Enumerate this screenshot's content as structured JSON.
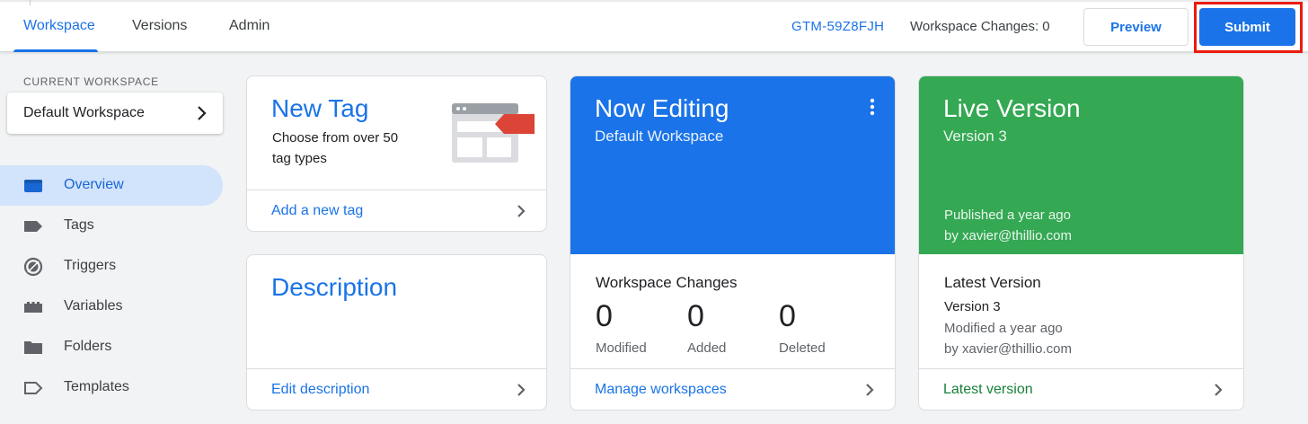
{
  "topbar": {
    "tabs": [
      {
        "label": "Workspace",
        "active": true
      },
      {
        "label": "Versions",
        "active": false
      },
      {
        "label": "Admin",
        "active": false
      }
    ],
    "container_id": "GTM-59Z8FJH",
    "workspace_changes": "Workspace Changes: 0",
    "preview_label": "Preview",
    "submit_label": "Submit",
    "highlight_color": "#ea1c0e"
  },
  "sidebar": {
    "current_workspace_label": "CURRENT WORKSPACE",
    "workspace_name": "Default Workspace",
    "items": [
      {
        "label": "Overview",
        "icon": "overview-icon",
        "active": true
      },
      {
        "label": "Tags",
        "icon": "tag-icon",
        "active": false
      },
      {
        "label": "Triggers",
        "icon": "trigger-icon",
        "active": false
      },
      {
        "label": "Variables",
        "icon": "variables-icon",
        "active": false
      },
      {
        "label": "Folders",
        "icon": "folder-icon",
        "active": false
      },
      {
        "label": "Templates",
        "icon": "template-icon",
        "active": false
      }
    ]
  },
  "new_tag_card": {
    "title": "New Tag",
    "subtitle_line1": "Choose from over 50",
    "subtitle_line2": "tag types",
    "link": "Add a new tag"
  },
  "description_card": {
    "title": "Description",
    "link": "Edit description"
  },
  "now_editing_card": {
    "title": "Now Editing",
    "subtitle": "Default Workspace",
    "color": "#1a73e8",
    "section_title": "Workspace Changes",
    "stats": [
      {
        "value": "0",
        "label": "Modified"
      },
      {
        "value": "0",
        "label": "Added"
      },
      {
        "value": "0",
        "label": "Deleted"
      }
    ],
    "link": "Manage workspaces"
  },
  "live_version_card": {
    "title": "Live Version",
    "subtitle": "Version 3",
    "published_line1": "Published a year ago",
    "published_line2": "by xavier@thillio.com",
    "color": "#34a853",
    "section_title": "Latest Version",
    "version": "Version 3",
    "modified_line1": "Modified a year ago",
    "modified_line2": "by xavier@thillio.com",
    "link": "Latest version",
    "link_color": "#188038"
  }
}
